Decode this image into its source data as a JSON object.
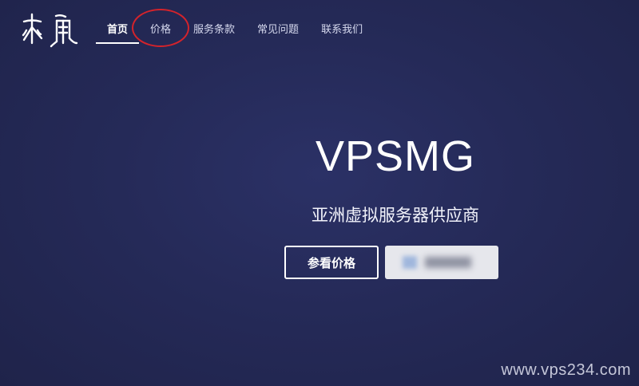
{
  "brand": {
    "logo_icon": "seal-script-logo-icon"
  },
  "nav": {
    "items": [
      {
        "label": "首页",
        "active": true
      },
      {
        "label": "价格",
        "active": false
      },
      {
        "label": "服务条款",
        "active": false
      },
      {
        "label": "常见问题",
        "active": false
      },
      {
        "label": "联系我们",
        "active": false
      }
    ]
  },
  "hero": {
    "title": "VPSMG",
    "subtitle": "亚洲虚拟服务器供应商",
    "primary_button": "参看价格",
    "secondary_button": ""
  },
  "watermark": "www.vps234.com",
  "colors": {
    "background": "#252a58",
    "text": "#ffffff",
    "annotation": "#d4232b",
    "secondary_button_bg": "#e6e7ec"
  }
}
